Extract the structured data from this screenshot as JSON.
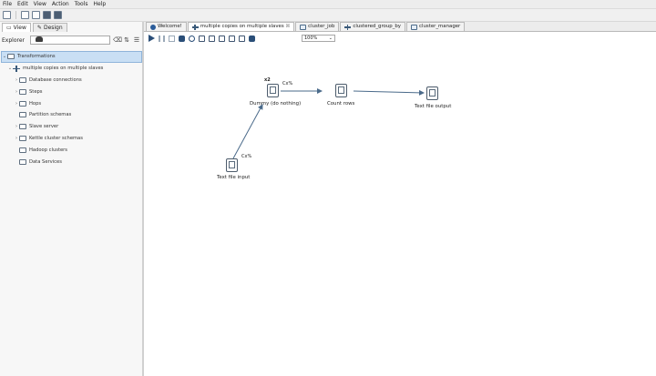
{
  "menu": [
    "File",
    "Edit",
    "View",
    "Action",
    "Tools",
    "Help"
  ],
  "left_panel": {
    "view_tab": "View",
    "design_tab": "Design",
    "explorer_label": "Explorer",
    "search_placeholder": "",
    "tree": {
      "root": "Transformations",
      "transformation": "multiple copies on multiple slaves",
      "items": [
        "Database connections",
        "Steps",
        "Hops",
        "Partition schemas",
        "Slave server",
        "Kettle cluster schemas",
        "Hadoop clusters",
        "Data Services"
      ]
    }
  },
  "editor": {
    "tabs": [
      {
        "label": "Welcome!",
        "close": ""
      },
      {
        "label": "multiple copies on multiple slaves",
        "close": "☒"
      },
      {
        "label": "cluster_job",
        "close": ""
      },
      {
        "label": "clustered_group_by",
        "close": ""
      },
      {
        "label": "cluster_manager",
        "close": ""
      }
    ],
    "zoom": "100%"
  },
  "canvas": {
    "steps": [
      {
        "name": "Dummy (do nothing)",
        "cxn": "Cx%",
        "copies": "x2"
      },
      {
        "name": "Count rows",
        "cxn": ""
      },
      {
        "name": "Text file output",
        "cxn": ""
      },
      {
        "name": "Text file input",
        "cxn": "Cx%"
      }
    ]
  },
  "colors": {
    "hop": "#4a6a8a",
    "selection": "#c9dff4"
  }
}
